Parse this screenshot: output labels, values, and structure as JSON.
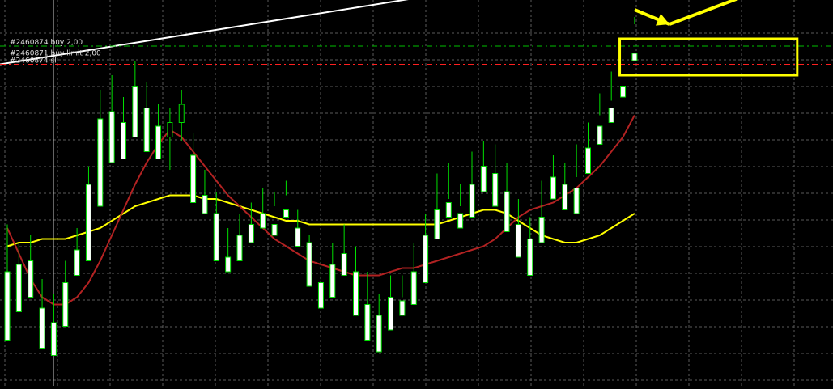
{
  "colors": {
    "background": "#000000",
    "grid": "#5a5a5a",
    "candle": "#00e000",
    "candle_body_up": "#000000",
    "candle_body_down": "#ffffff",
    "ma_fast": "#ffff00",
    "ma_slow": "#b22222",
    "trendline": "#ffffff",
    "buy_line": "#00c000",
    "sl_line": "#ff2020",
    "annotation": "#ffff00",
    "label_text": "#e0e0e0"
  },
  "chart_data": {
    "type": "candlestick",
    "grid": true,
    "ylim": [
      0,
      100
    ],
    "candles": [
      [
        28,
        9,
        41,
        20
      ],
      [
        30,
        17,
        36,
        22
      ],
      [
        31,
        21,
        38,
        29
      ],
      [
        18,
        7,
        26,
        11
      ],
      [
        14,
        5,
        22,
        10
      ],
      [
        25,
        13,
        31,
        16
      ],
      [
        34,
        27,
        40,
        30
      ],
      [
        52,
        31,
        57,
        35
      ],
      [
        70,
        46,
        78,
        48
      ],
      [
        72,
        58,
        82,
        66
      ],
      [
        69,
        59,
        76,
        63
      ],
      [
        79,
        65,
        86,
        76
      ],
      [
        73,
        61,
        80,
        67
      ],
      [
        68,
        59,
        74,
        64
      ],
      [
        65,
        69,
        73,
        56
      ],
      [
        69,
        74,
        78,
        64
      ],
      [
        60,
        47,
        66,
        50
      ],
      [
        49,
        44,
        56,
        47
      ],
      [
        44,
        31,
        50,
        34
      ],
      [
        32,
        28,
        40,
        30
      ],
      [
        38,
        31,
        44,
        34
      ],
      [
        41,
        36,
        47,
        38
      ],
      [
        44,
        40,
        51,
        43
      ],
      [
        41,
        38,
        50,
        46
      ],
      [
        45,
        43,
        53,
        49
      ],
      [
        40,
        35,
        45,
        38
      ],
      [
        36,
        24,
        38,
        27
      ],
      [
        25,
        18,
        31,
        23
      ],
      [
        30,
        21,
        36,
        24
      ],
      [
        33,
        27,
        41,
        31
      ],
      [
        28,
        16,
        35,
        19
      ],
      [
        19,
        9,
        28,
        13
      ],
      [
        16,
        6,
        22,
        9
      ],
      [
        21,
        12,
        27,
        18
      ],
      [
        20,
        16,
        27,
        21
      ],
      [
        28,
        19,
        36,
        24
      ],
      [
        38,
        25,
        44,
        31
      ],
      [
        45,
        37,
        55,
        44
      ],
      [
        47,
        43,
        58,
        48
      ],
      [
        44,
        40,
        52,
        46
      ],
      [
        52,
        43,
        61,
        49
      ],
      [
        57,
        50,
        64,
        56
      ],
      [
        55,
        46,
        63,
        52
      ],
      [
        50,
        39,
        58,
        45
      ],
      [
        41,
        32,
        48,
        38
      ],
      [
        37,
        27,
        43,
        31
      ],
      [
        43,
        36,
        53,
        42
      ],
      [
        54,
        48,
        60,
        52
      ],
      [
        52,
        45,
        58,
        49
      ],
      [
        51,
        44,
        63,
        54
      ],
      [
        62,
        55,
        69,
        59
      ],
      [
        68,
        63,
        77,
        71
      ],
      [
        73,
        69,
        83,
        75
      ],
      [
        79,
        76,
        92,
        88
      ],
      [
        88,
        86,
        98,
        96
      ]
    ],
    "moving_averages": [
      {
        "color_key": "ma_fast",
        "values": [
          35,
          36,
          36,
          37,
          37,
          37,
          38,
          39,
          40,
          42,
          44,
          46,
          47,
          48,
          49,
          49,
          49,
          48,
          48,
          47,
          46,
          45,
          44,
          43,
          42,
          42,
          41,
          41,
          41,
          41,
          41,
          41,
          41,
          41,
          41,
          41,
          41,
          41,
          42,
          43,
          44,
          45,
          45,
          44,
          42,
          40,
          38,
          37,
          36,
          36,
          37,
          38,
          40,
          42,
          44
        ]
      },
      {
        "color_key": "ma_slow",
        "values": [
          40,
          33,
          26,
          21,
          19,
          19,
          21,
          25,
          31,
          38,
          45,
          52,
          58,
          63,
          67,
          65,
          61,
          57,
          53,
          49,
          46,
          43,
          40,
          37,
          35,
          33,
          31,
          30,
          29,
          28,
          27,
          27,
          27,
          28,
          29,
          29,
          30,
          31,
          32,
          33,
          34,
          35,
          37,
          40,
          43,
          45,
          46,
          47,
          49,
          51,
          54,
          57,
          61,
          65,
          71
        ]
      }
    ],
    "trendline": {
      "from": [
        0,
        85
      ],
      "to": [
        54,
        113
      ]
    },
    "order_lines": [
      {
        "label": "#2460874 buy 2,00",
        "y": 90,
        "color_key": "buy_line"
      },
      {
        "label": "#2460871 buy limit 2,00",
        "y": 87,
        "color_key": "buy_line"
      },
      {
        "label": "#2460874 sl",
        "y": 85,
        "color_key": "sl_line"
      }
    ],
    "annotations": {
      "box": {
        "from_index": 53,
        "to_index": 68,
        "y_top": 92,
        "y_bottom": 82
      },
      "arrows": [
        {
          "from": [
            54,
            100
          ],
          "to": [
            57,
            96
          ]
        },
        {
          "from": [
            57,
            96
          ],
          "to": [
            67,
            108
          ]
        }
      ]
    }
  }
}
